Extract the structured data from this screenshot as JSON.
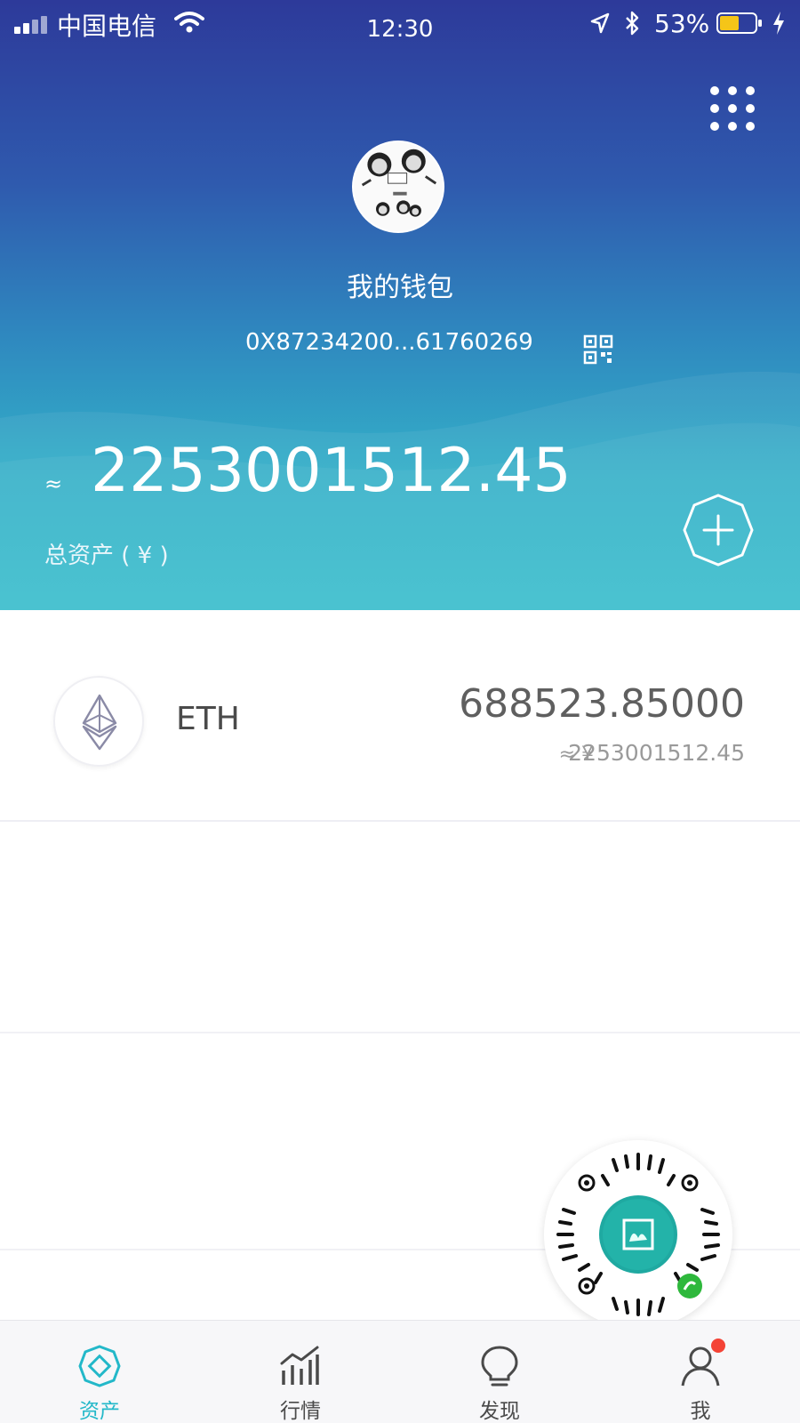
{
  "status_bar": {
    "carrier": "中国电信",
    "time": "12:30",
    "battery_percent": "53%",
    "battery_level": 0.53
  },
  "wallet": {
    "name": "我的钱包",
    "address": "0X87234200...61760269"
  },
  "summary": {
    "approx_symbol": "≈",
    "total_amount": "2253001512.45",
    "total_label": "总资产 ( ¥ )"
  },
  "assets": [
    {
      "symbol": "ETH",
      "balance": "688523.85000",
      "value_prefix": "≈ ¥",
      "value": "2253001512.45",
      "icon": "ethereum-icon"
    }
  ],
  "tabs": [
    {
      "label": "资产",
      "icon": "asset-icon",
      "active": true
    },
    {
      "label": "行情",
      "icon": "market-chart-icon",
      "active": false
    },
    {
      "label": "发现",
      "icon": "lightbulb-icon",
      "active": false
    },
    {
      "label": "我",
      "icon": "user-icon",
      "active": false,
      "badge": true
    }
  ],
  "colors": {
    "accent": "#23b8c9",
    "header_top": "#2d3a9a",
    "header_bottom": "#36bccb",
    "badge": "#f44336"
  }
}
